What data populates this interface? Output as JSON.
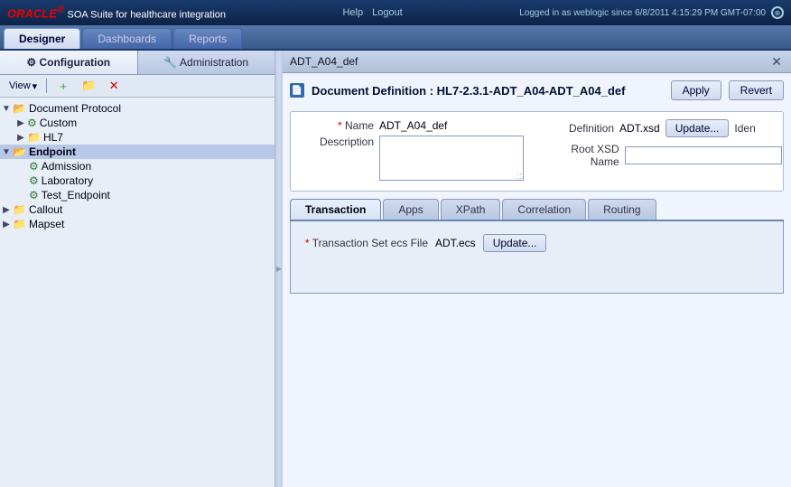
{
  "app": {
    "name": "ORACLE",
    "subtitle": "SOA Suite for healthcare integration",
    "toplinks": {
      "help": "Help",
      "logout": "Logout"
    },
    "session": "Logged in as weblogic since 6/8/2011 4:15:29 PM GMT-07:00"
  },
  "nav": {
    "tabs": [
      {
        "id": "designer",
        "label": "Designer",
        "active": true
      },
      {
        "id": "dashboards",
        "label": "Dashboards",
        "active": false
      },
      {
        "id": "reports",
        "label": "Reports",
        "active": false
      }
    ]
  },
  "left_panel": {
    "sub_tabs": [
      {
        "id": "configuration",
        "label": "Configuration",
        "active": true
      },
      {
        "id": "administration",
        "label": "Administration",
        "active": false
      }
    ],
    "toolbar": {
      "view_label": "View",
      "add_tooltip": "Add",
      "folder_tooltip": "Folder",
      "delete_tooltip": "Delete"
    },
    "tree": [
      {
        "id": "doc-protocol",
        "label": "Document Protocol",
        "level": 0,
        "type": "folder",
        "expanded": true
      },
      {
        "id": "custom",
        "label": "Custom",
        "level": 1,
        "type": "gear",
        "expanded": false
      },
      {
        "id": "hl7",
        "label": "HL7",
        "level": 1,
        "type": "folder",
        "expanded": false
      },
      {
        "id": "endpoint",
        "label": "Endpoint",
        "level": 0,
        "type": "folder",
        "expanded": true,
        "selected": true
      },
      {
        "id": "admission",
        "label": "Admission",
        "level": 1,
        "type": "gear"
      },
      {
        "id": "laboratory",
        "label": "Laboratory",
        "level": 1,
        "type": "gear"
      },
      {
        "id": "test-endpoint",
        "label": "Test_Endpoint",
        "level": 1,
        "type": "gear"
      },
      {
        "id": "callout",
        "label": "Callout",
        "level": 0,
        "type": "folder"
      },
      {
        "id": "mapset",
        "label": "Mapset",
        "level": 0,
        "type": "folder"
      }
    ]
  },
  "doc_panel": {
    "title": "ADT_A04_def",
    "def_title": "Document Definition : HL7-2.3.1-ADT_A04-ADT_A04_def",
    "apply_label": "Apply",
    "revert_label": "Revert",
    "form": {
      "name_label": "Name",
      "name_value": "ADT_A04_def",
      "description_label": "Description",
      "definition_label": "Definition",
      "definition_value": "ADT.xsd",
      "update_label": "Update...",
      "root_xsd_label": "Root XSD Name",
      "iden_label": "Iden"
    },
    "tabs": [
      {
        "id": "transaction",
        "label": "Transaction",
        "active": true
      },
      {
        "id": "apps",
        "label": "Apps",
        "active": false
      },
      {
        "id": "xpath",
        "label": "XPath",
        "active": false
      },
      {
        "id": "correlation",
        "label": "Correlation",
        "active": false
      },
      {
        "id": "routing",
        "label": "Routing",
        "active": false
      }
    ],
    "transaction_tab": {
      "field_label": "Transaction Set ecs File",
      "field_value": "ADT.ecs",
      "update_label": "Update..."
    }
  }
}
